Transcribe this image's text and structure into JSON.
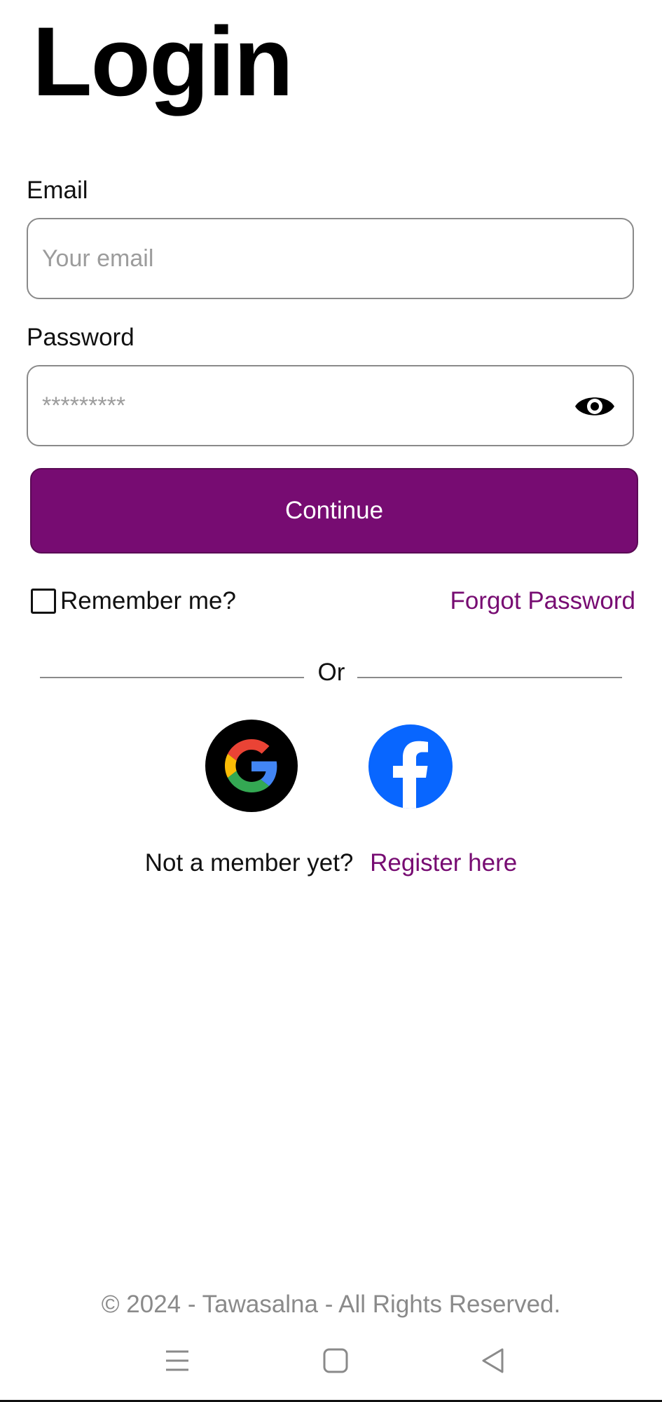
{
  "page": {
    "title": "Login"
  },
  "email": {
    "label": "Email",
    "placeholder": "Your email",
    "value": ""
  },
  "password": {
    "label": "Password",
    "placeholder": "*********",
    "value": "",
    "toggle_icon": "eye-icon"
  },
  "actions": {
    "continue_label": "Continue",
    "remember_label": "Remember me?",
    "remember_checked": false,
    "forgot_label": "Forgot Password"
  },
  "divider": {
    "text": "Or"
  },
  "social": {
    "google_icon": "google-icon",
    "facebook_icon": "facebook-icon"
  },
  "register": {
    "question": "Not a member yet?",
    "link_label": "Register here"
  },
  "footer": {
    "copyright": "© 2024 - Tawasalna - All Rights Reserved."
  },
  "system_nav": {
    "icons": [
      "menu-icon",
      "home-icon",
      "back-icon"
    ]
  },
  "colors": {
    "primary": "#770c72",
    "text": "#111111",
    "muted": "#8a8a8a",
    "facebook": "#0866ff"
  }
}
